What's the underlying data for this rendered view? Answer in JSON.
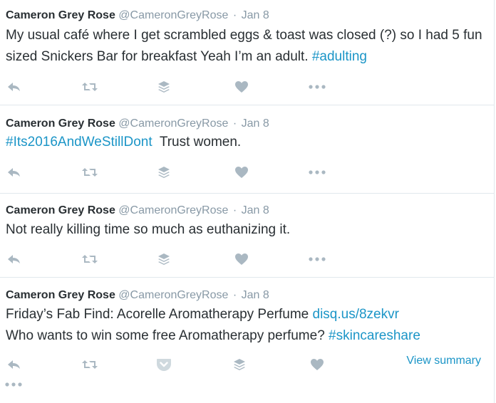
{
  "tweets": [
    {
      "fullname": "Cameron Grey Rose",
      "username": "@CameronGreyRose",
      "separator": "·",
      "time": "Jan 8",
      "text_parts": [
        "My usual café where I get scrambled eggs & toast was closed (?) so I had 5 fun sized Snickers Bar for breakfast Yeah I’m an adult. "
      ],
      "hashtag": "#adulting"
    },
    {
      "fullname": "Cameron Grey Rose",
      "username": "@CameronGreyRose",
      "separator": "·",
      "time": "Jan 8",
      "hashtag": "#Its2016AndWeStillDont",
      "text_after": "  Trust women."
    },
    {
      "fullname": "Cameron Grey Rose",
      "username": "@CameronGreyRose",
      "separator": "·",
      "time": "Jan 8",
      "text": "Not really killing time so much as euthanizing it."
    },
    {
      "fullname": "Cameron Grey Rose",
      "username": "@CameronGreyRose",
      "separator": "·",
      "time": "Jan 8",
      "text_before": "Friday’s Fab Find: Acorelle Aromatherapy Perfume ",
      "link": "disq.us/8zekvr",
      "text_line2": "Who wants to win some free Aromatherapy perfume? ",
      "hashtag": "#skincareshare",
      "view_summary": "View summary"
    }
  ],
  "icons": {
    "reply": "reply-icon",
    "retweet": "retweet-icon",
    "buffer": "buffer-stack-icon",
    "like": "heart-icon",
    "more": "more-dots-icon",
    "pocket": "pocket-icon"
  },
  "colors": {
    "icon": "#aab8c2",
    "link": "#1b95c7",
    "text": "#292f33",
    "meta": "#8899a6",
    "divider": "#e1e8ed"
  }
}
